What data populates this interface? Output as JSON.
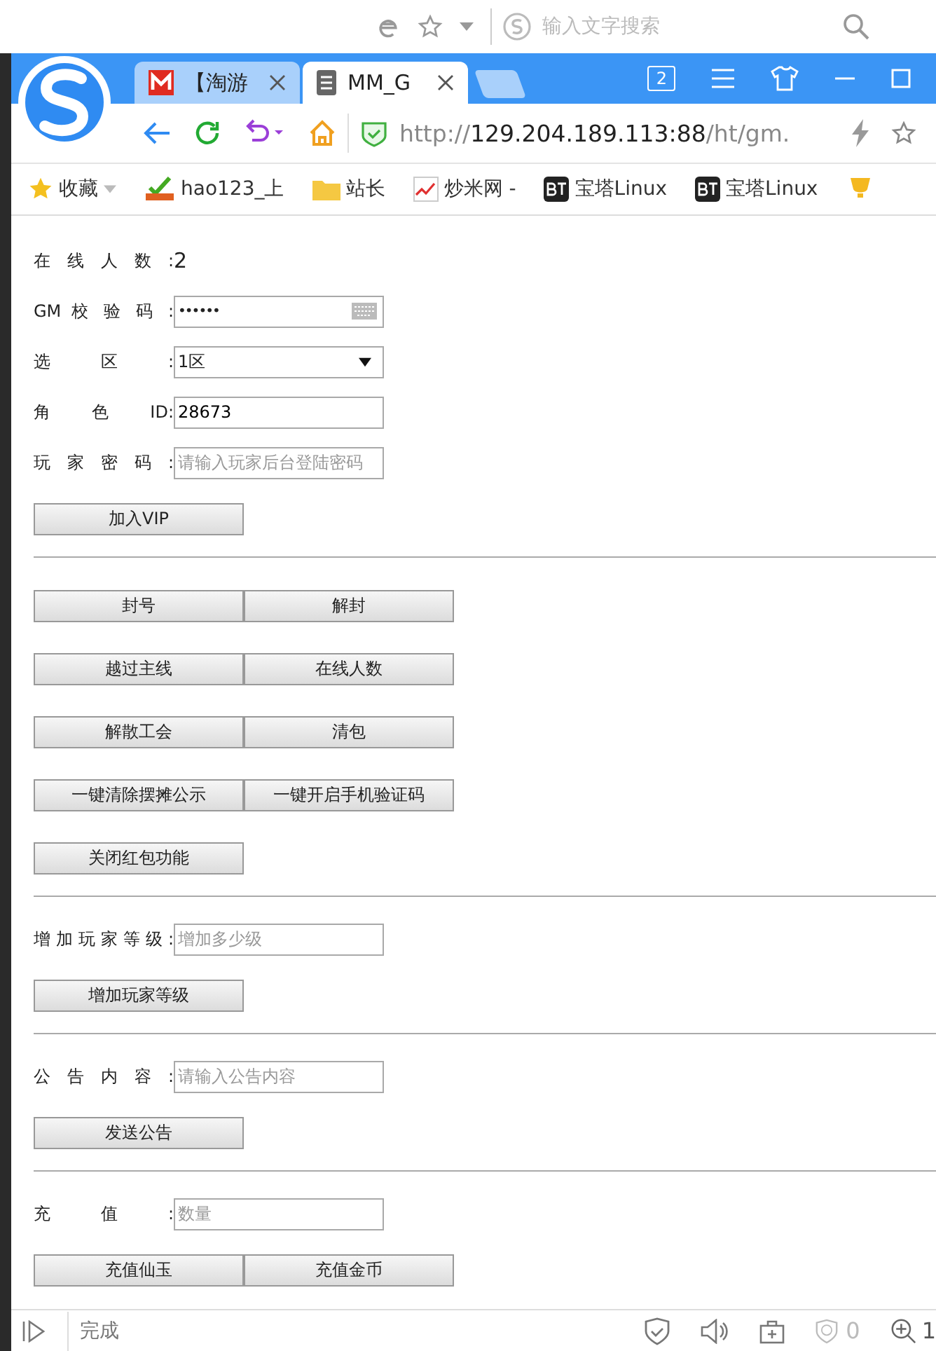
{
  "backdrop": {
    "search_placeholder": "输入文字搜索"
  },
  "tabs": [
    {
      "title": "【淘游",
      "selected": false
    },
    {
      "title": "MM_G",
      "selected": true
    }
  ],
  "tab_count": "2",
  "address": {
    "scheme": "http://",
    "host": "129.204.189.113:88",
    "path": "/ht/gm."
  },
  "bookmarks": [
    {
      "label": "收藏",
      "kind": "star"
    },
    {
      "label": "hao123_上",
      "kind": "hao"
    },
    {
      "label": "站长",
      "kind": "folder"
    },
    {
      "label": "炒米网 -",
      "kind": "chart"
    },
    {
      "label": "宝塔Linux",
      "kind": "bt"
    },
    {
      "label": "宝塔Linux",
      "kind": "bt"
    }
  ],
  "sections": [
    {
      "rows": [
        {
          "kind": "text",
          "label": "在 线 人 数 :",
          "value": "2"
        },
        {
          "kind": "password",
          "label": "GM 校 验 码 :",
          "value": "••••••"
        },
        {
          "kind": "select",
          "label": "选 区 :",
          "value": "1区"
        },
        {
          "kind": "input",
          "label": "角 色 ID:",
          "value": "28673"
        },
        {
          "kind": "input",
          "label": "玩 家 密 码 :",
          "placeholder": "请输入玩家后台登陆密码"
        }
      ],
      "button_rows": [
        [
          "加入VIP"
        ]
      ]
    },
    {
      "button_rows": [
        [
          "封号",
          "解封"
        ],
        [
          "越过主线",
          "在线人数"
        ],
        [
          "解散工会",
          "清包"
        ],
        [
          "一键清除摆摊公示",
          "一键开启手机验证码"
        ],
        [
          "关闭红包功能"
        ]
      ]
    },
    {
      "rows": [
        {
          "kind": "input",
          "label": "增 加 玩 家 等 级 :",
          "placeholder": "增加多少级"
        }
      ],
      "button_rows": [
        [
          "增加玩家等级"
        ]
      ]
    },
    {
      "rows": [
        {
          "kind": "input",
          "label": "公 告 内 容 :",
          "placeholder": "请输入公告内容"
        }
      ],
      "button_rows": [
        [
          "发送公告"
        ]
      ]
    },
    {
      "rows": [
        {
          "kind": "input",
          "label": "充 值 :",
          "placeholder": "数量"
        }
      ],
      "button_rows": [
        [
          "充值仙玉",
          "充值金币"
        ]
      ]
    }
  ],
  "status_bar": {
    "text": "完成",
    "ad_count": "0",
    "zoom": "1"
  }
}
